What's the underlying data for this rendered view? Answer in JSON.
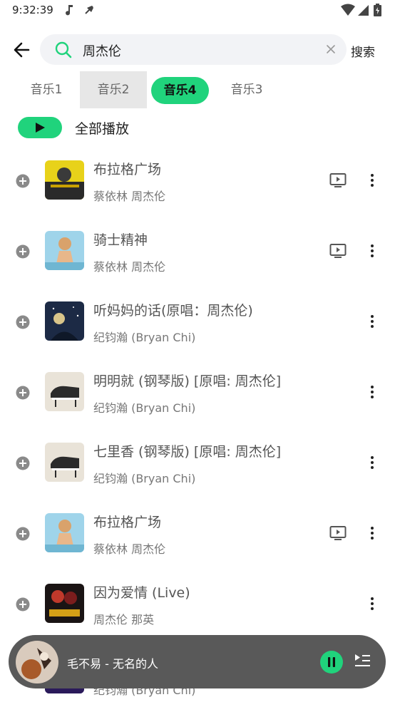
{
  "status": {
    "time": "9:32:39"
  },
  "search": {
    "query": "周杰伦",
    "button": "搜索"
  },
  "tabs": [
    {
      "label": "音乐1"
    },
    {
      "label": "音乐2"
    },
    {
      "label": "音乐4"
    },
    {
      "label": "音乐3"
    }
  ],
  "play_all": "全部播放",
  "songs": [
    {
      "title": "布拉格广场",
      "artist": "蔡依林 周杰伦",
      "has_mv": true
    },
    {
      "title": "骑士精神",
      "artist": "蔡依林 周杰伦",
      "has_mv": true
    },
    {
      "title": "听妈妈的话(原唱：周杰伦)",
      "artist": "纪钧瀚 (Bryan Chi)",
      "has_mv": false
    },
    {
      "title": "明明就 (钢琴版) [原唱: 周杰伦]",
      "artist": "纪钧瀚 (Bryan Chi)",
      "has_mv": false
    },
    {
      "title": "七里香 (钢琴版) [原唱: 周杰伦]",
      "artist": "纪钧瀚 (Bryan Chi)",
      "has_mv": false
    },
    {
      "title": "布拉格广场",
      "artist": "蔡依林 周杰伦",
      "has_mv": true
    },
    {
      "title": "因为爱情 (Live)",
      "artist": "周杰伦 那英",
      "has_mv": false
    },
    {
      "title": "",
      "artist": "纪钧瀚 (Bryan Chi)",
      "has_mv": false
    }
  ],
  "player": {
    "title": "毛不易 - 无名的人"
  },
  "colors": {
    "accent": "#20d37c",
    "player_bg": "#595959"
  }
}
